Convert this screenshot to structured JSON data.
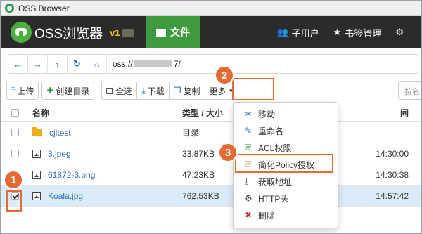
{
  "window": {
    "title": "OSS Browser"
  },
  "appbar": {
    "logo_text": "OSS浏览器",
    "version": "v1",
    "file_tab": "文件",
    "nav": [
      {
        "icon": "users-icon",
        "label": "子用户"
      },
      {
        "icon": "star-icon",
        "label": "书签管理"
      },
      {
        "icon": "gear-icon",
        "label": ""
      }
    ]
  },
  "address": {
    "prefix": "oss://",
    "suffix": "7/"
  },
  "toolbar": {
    "upload": "上传",
    "create_dir": "创建目录",
    "select_all": "全选",
    "download": "下载",
    "copy": "复制",
    "more": "更多",
    "search_placeholder": "按名称"
  },
  "table": {
    "headers": {
      "name": "名称",
      "type_size": "类型 / 大小",
      "time": "间"
    },
    "rows": [
      {
        "name": "cjltest",
        "type": "目录",
        "time": "",
        "kind": "folder",
        "checked": false
      },
      {
        "name": "3.jpeg",
        "type": "33.87KB",
        "time": "14:30:00",
        "kind": "image",
        "checked": false
      },
      {
        "name": "61872-3.png",
        "type": "47.23KB",
        "time": "14:30:38",
        "kind": "image",
        "checked": false
      },
      {
        "name": "Koala.jpg",
        "type": "762.53KB",
        "time": "14:57:42",
        "kind": "image",
        "checked": true
      }
    ]
  },
  "menu": {
    "items": [
      {
        "icon": "scissors-icon",
        "label": "移动"
      },
      {
        "icon": "edit-icon",
        "label": "重命名"
      },
      {
        "icon": "shield-icon",
        "label": "ACL权限"
      },
      {
        "icon": "shield-icon",
        "label": "简化Policy授权"
      },
      {
        "icon": "download-icon",
        "label": "获取地址"
      },
      {
        "icon": "gear-icon",
        "label": "HTTP头"
      },
      {
        "icon": "close-icon",
        "label": "删除"
      }
    ]
  },
  "badges": [
    "1",
    "2",
    "3"
  ],
  "colors": {
    "accent": "#3d9a3f",
    "highlight": "#e46b34",
    "link": "#2a6fb1",
    "selected_row": "#d9ecf7"
  }
}
